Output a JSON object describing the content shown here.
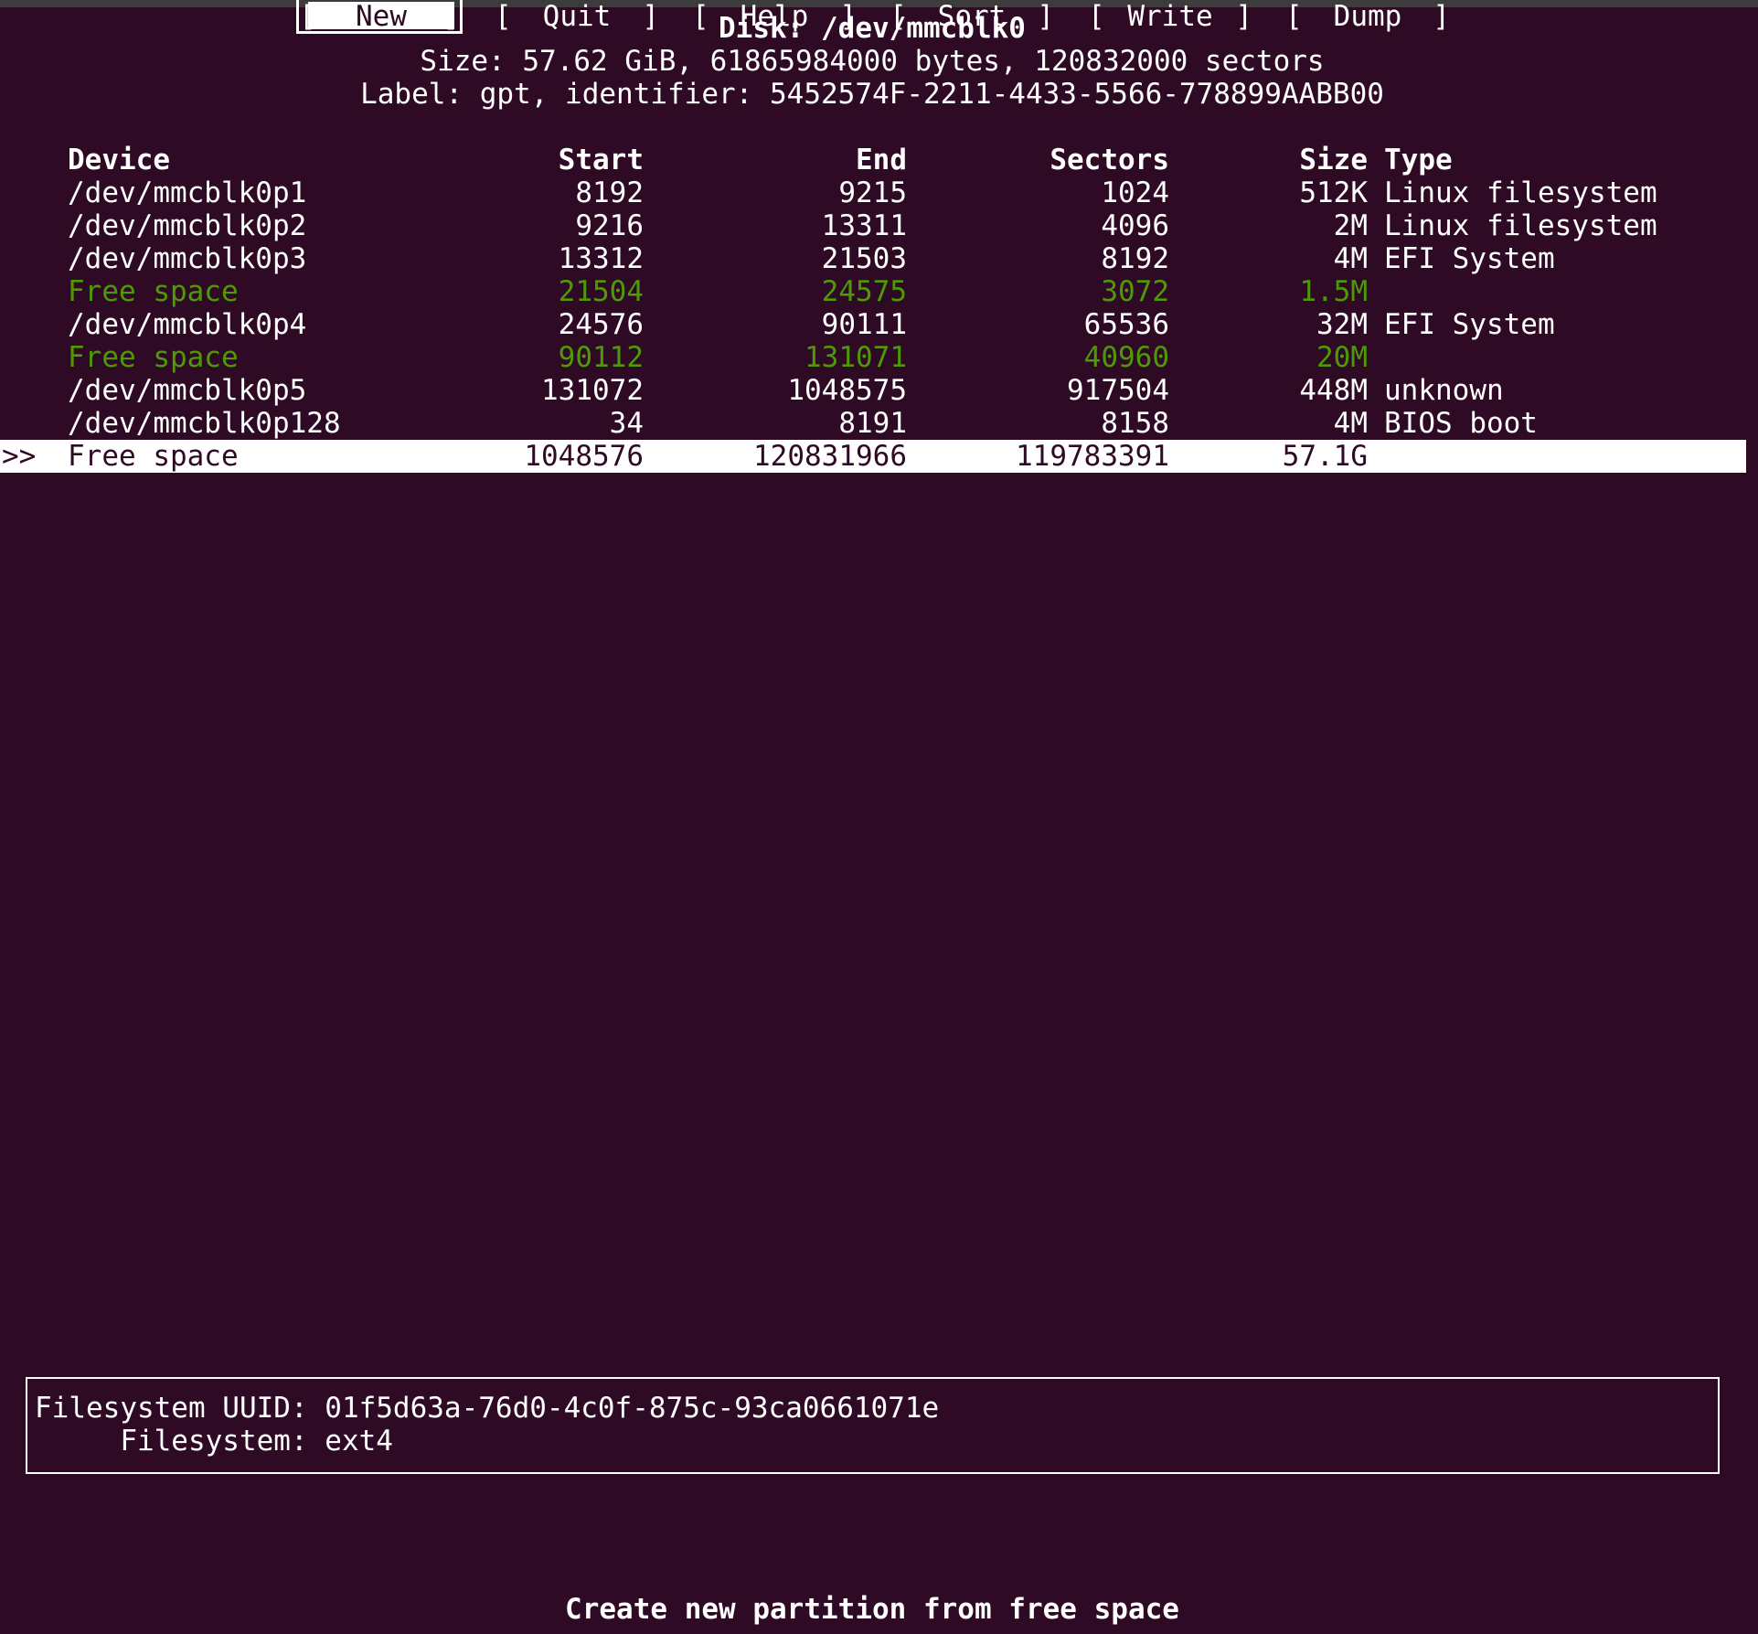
{
  "header": {
    "disk_line": "Disk: /dev/mmcblk0",
    "size_line": "Size: 57.62 GiB, 61865984000 bytes, 120832000 sectors",
    "label_line": "Label: gpt, identifier: 5452574F-2211-4433-5566-778899AABB00"
  },
  "table": {
    "columns": {
      "device": "Device",
      "start": "Start",
      "end": "End",
      "sectors": "Sectors",
      "size": "Size",
      "type": "Type"
    },
    "rows": [
      {
        "marker": "",
        "device": "/dev/mmcblk0p1",
        "start": "8192",
        "end": "9215",
        "sectors": "1024",
        "size": "512K",
        "type": "Linux filesystem"
      },
      {
        "marker": "",
        "device": "/dev/mmcblk0p2",
        "start": "9216",
        "end": "13311",
        "sectors": "4096",
        "size": "2M",
        "type": "Linux filesystem"
      },
      {
        "marker": "",
        "device": "/dev/mmcblk0p3",
        "start": "13312",
        "end": "21503",
        "sectors": "8192",
        "size": "4M",
        "type": "EFI System"
      },
      {
        "marker": "",
        "device": "Free space",
        "start": "21504",
        "end": "24575",
        "sectors": "3072",
        "size": "1.5M",
        "type": ""
      },
      {
        "marker": "",
        "device": "/dev/mmcblk0p4",
        "start": "24576",
        "end": "90111",
        "sectors": "65536",
        "size": "32M",
        "type": "EFI System"
      },
      {
        "marker": "",
        "device": "Free space",
        "start": "90112",
        "end": "131071",
        "sectors": "40960",
        "size": "20M",
        "type": ""
      },
      {
        "marker": "",
        "device": "/dev/mmcblk0p5",
        "start": "131072",
        "end": "1048575",
        "sectors": "917504",
        "size": "448M",
        "type": "unknown"
      },
      {
        "marker": "",
        "device": "/dev/mmcblk0p128",
        "start": "34",
        "end": "8191",
        "sectors": "8158",
        "size": "4M",
        "type": "BIOS boot"
      },
      {
        "marker": ">>",
        "device": "Free space",
        "start": "1048576",
        "end": "120831966",
        "sectors": "119783391",
        "size": "57.1G",
        "type": ""
      }
    ]
  },
  "info": {
    "uuid_line": "Filesystem UUID: 01f5d63a-76d0-4c0f-875c-93ca0661071e",
    "fs_line": "     Filesystem: ext4"
  },
  "menu": {
    "items": [
      {
        "label": "New"
      },
      {
        "label": "Quit"
      },
      {
        "label": "Help"
      },
      {
        "label": "Sort"
      },
      {
        "label": "Write"
      },
      {
        "label": "Dump"
      }
    ],
    "open_bracket": "[",
    "close_bracket": "]"
  },
  "hint": "Create new partition from free space",
  "colors": {
    "background": "#2f0a24",
    "free_space": "#4e9a06",
    "text": "#ffffff"
  }
}
